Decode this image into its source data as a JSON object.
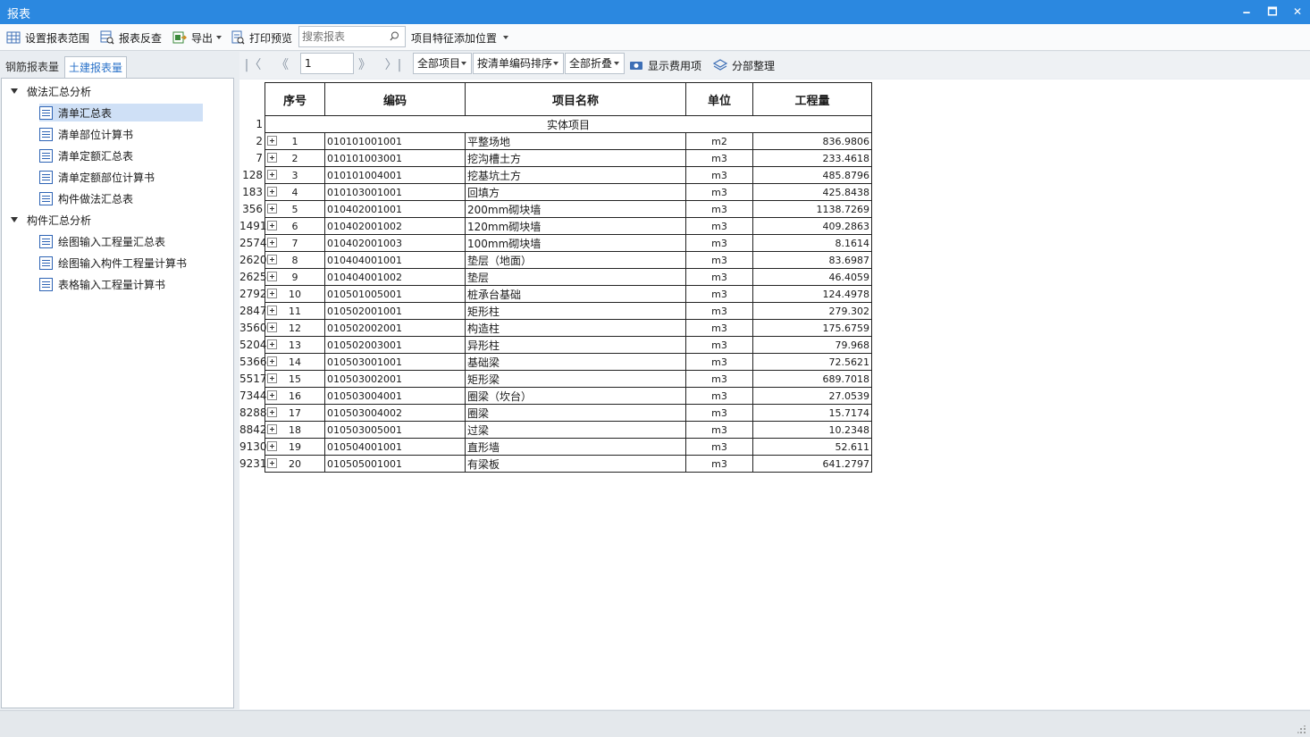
{
  "window": {
    "title": "报表",
    "minimize": "🗕",
    "maximize": "🗖",
    "close": "✕"
  },
  "toolbar": {
    "set_range": "设置报表范围",
    "reverse_check": "报表反查",
    "export": "导出",
    "print_preview": "打印预览",
    "search_placeholder": "搜索报表",
    "add_feature_position": "项目特征添加位置"
  },
  "tabs": {
    "rebar": "钢筋报表量",
    "civil": "土建报表量"
  },
  "tree": {
    "group1": "做法汇总分析",
    "group1_items": [
      "清单汇总表",
      "清单部位计算书",
      "清单定额汇总表",
      "清单定额部位计算书",
      "构件做法汇总表"
    ],
    "group2": "构件汇总分析",
    "group2_items": [
      "绘图输入工程量汇总表",
      "绘图输入构件工程量计算书",
      "表格输入工程量计算书"
    ]
  },
  "nav": {
    "first": "|〈",
    "prev": "《",
    "page": "1",
    "next": "》",
    "last": "〉|",
    "filter_all": "全部项目",
    "sort_by_code": "按清单编码排序",
    "collapse_all": "全部折叠",
    "show_costs": "显示费用项",
    "section_organize": "分部整理"
  },
  "table": {
    "headers": [
      "序号",
      "编码",
      "项目名称",
      "单位",
      "工程量"
    ],
    "section_title": "实体项目",
    "section_row_num": "1",
    "rows": [
      {
        "rn": "2",
        "no": "1",
        "code": "010101001001",
        "name": "平整场地",
        "unit": "m2",
        "qty": "836.9806"
      },
      {
        "rn": "7",
        "no": "2",
        "code": "010101003001",
        "name": "挖沟槽土方",
        "unit": "m3",
        "qty": "233.4618"
      },
      {
        "rn": "128",
        "no": "3",
        "code": "010101004001",
        "name": "挖基坑土方",
        "unit": "m3",
        "qty": "485.8796"
      },
      {
        "rn": "183",
        "no": "4",
        "code": "010103001001",
        "name": "回填方",
        "unit": "m3",
        "qty": "425.8438"
      },
      {
        "rn": "356",
        "no": "5",
        "code": "010402001001",
        "name": "200mm砌块墙",
        "unit": "m3",
        "qty": "1138.7269"
      },
      {
        "rn": "1491",
        "no": "6",
        "code": "010402001002",
        "name": "120mm砌块墙",
        "unit": "m3",
        "qty": "409.2863"
      },
      {
        "rn": "2574",
        "no": "7",
        "code": "010402001003",
        "name": "100mm砌块墙",
        "unit": "m3",
        "qty": "8.1614"
      },
      {
        "rn": "2620",
        "no": "8",
        "code": "010404001001",
        "name": "垫层（地面）",
        "unit": "m3",
        "qty": "83.6987"
      },
      {
        "rn": "2625",
        "no": "9",
        "code": "010404001002",
        "name": "垫层",
        "unit": "m3",
        "qty": "46.4059"
      },
      {
        "rn": "2792",
        "no": "10",
        "code": "010501005001",
        "name": "桩承台基础",
        "unit": "m3",
        "qty": "124.4978"
      },
      {
        "rn": "2847",
        "no": "11",
        "code": "010502001001",
        "name": "矩形柱",
        "unit": "m3",
        "qty": "279.302"
      },
      {
        "rn": "3560",
        "no": "12",
        "code": "010502002001",
        "name": "构造柱",
        "unit": "m3",
        "qty": "175.6759"
      },
      {
        "rn": "5204",
        "no": "13",
        "code": "010502003001",
        "name": "异形柱",
        "unit": "m3",
        "qty": "79.968"
      },
      {
        "rn": "5366",
        "no": "14",
        "code": "010503001001",
        "name": "基础梁",
        "unit": "m3",
        "qty": "72.5621"
      },
      {
        "rn": "5517",
        "no": "15",
        "code": "010503002001",
        "name": "矩形梁",
        "unit": "m3",
        "qty": "689.7018"
      },
      {
        "rn": "7344",
        "no": "16",
        "code": "010503004001",
        "name": "圈梁（坎台）",
        "unit": "m3",
        "qty": "27.0539"
      },
      {
        "rn": "8288",
        "no": "17",
        "code": "010503004002",
        "name": "圈梁",
        "unit": "m3",
        "qty": "15.7174"
      },
      {
        "rn": "8842",
        "no": "18",
        "code": "010503005001",
        "name": "过梁",
        "unit": "m3",
        "qty": "10.2348"
      },
      {
        "rn": "9130",
        "no": "19",
        "code": "010504001001",
        "name": "直形墙",
        "unit": "m3",
        "qty": "52.611"
      },
      {
        "rn": "9231",
        "no": "20",
        "code": "010505001001",
        "name": "有梁板",
        "unit": "m3",
        "qty": "641.2797"
      }
    ]
  }
}
